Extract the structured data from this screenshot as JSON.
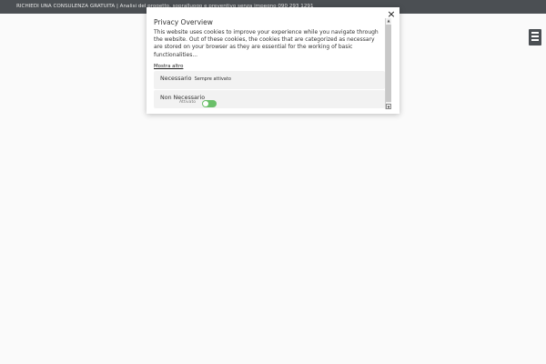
{
  "topbar": {
    "text": "RICHIEDI UNA CONSULENZA GRATUITA | Analisi del progetto, sopralluogo e preventivo senza impegno 090 293 1291"
  },
  "modal": {
    "title": "Privacy Overview",
    "body": "This website uses cookies to improve your experience while you navigate through the website. Out of these cookies, the cookies that are categorized as necessary are stored on your browser as they are essential for the working of basic functionalities...",
    "show_more": "Mostra altro",
    "close_label": "×",
    "sections": [
      {
        "title": "Necessario",
        "badge": "Sempre attivato"
      },
      {
        "title": "Non Necessario",
        "state": "Attivato",
        "enabled": true
      }
    ]
  },
  "icons": {
    "menu": "hamburger-menu-icon",
    "close": "close-icon"
  },
  "colors": {
    "topbar_bg": "#4b4f53",
    "toggle_on": "#6abf69"
  }
}
